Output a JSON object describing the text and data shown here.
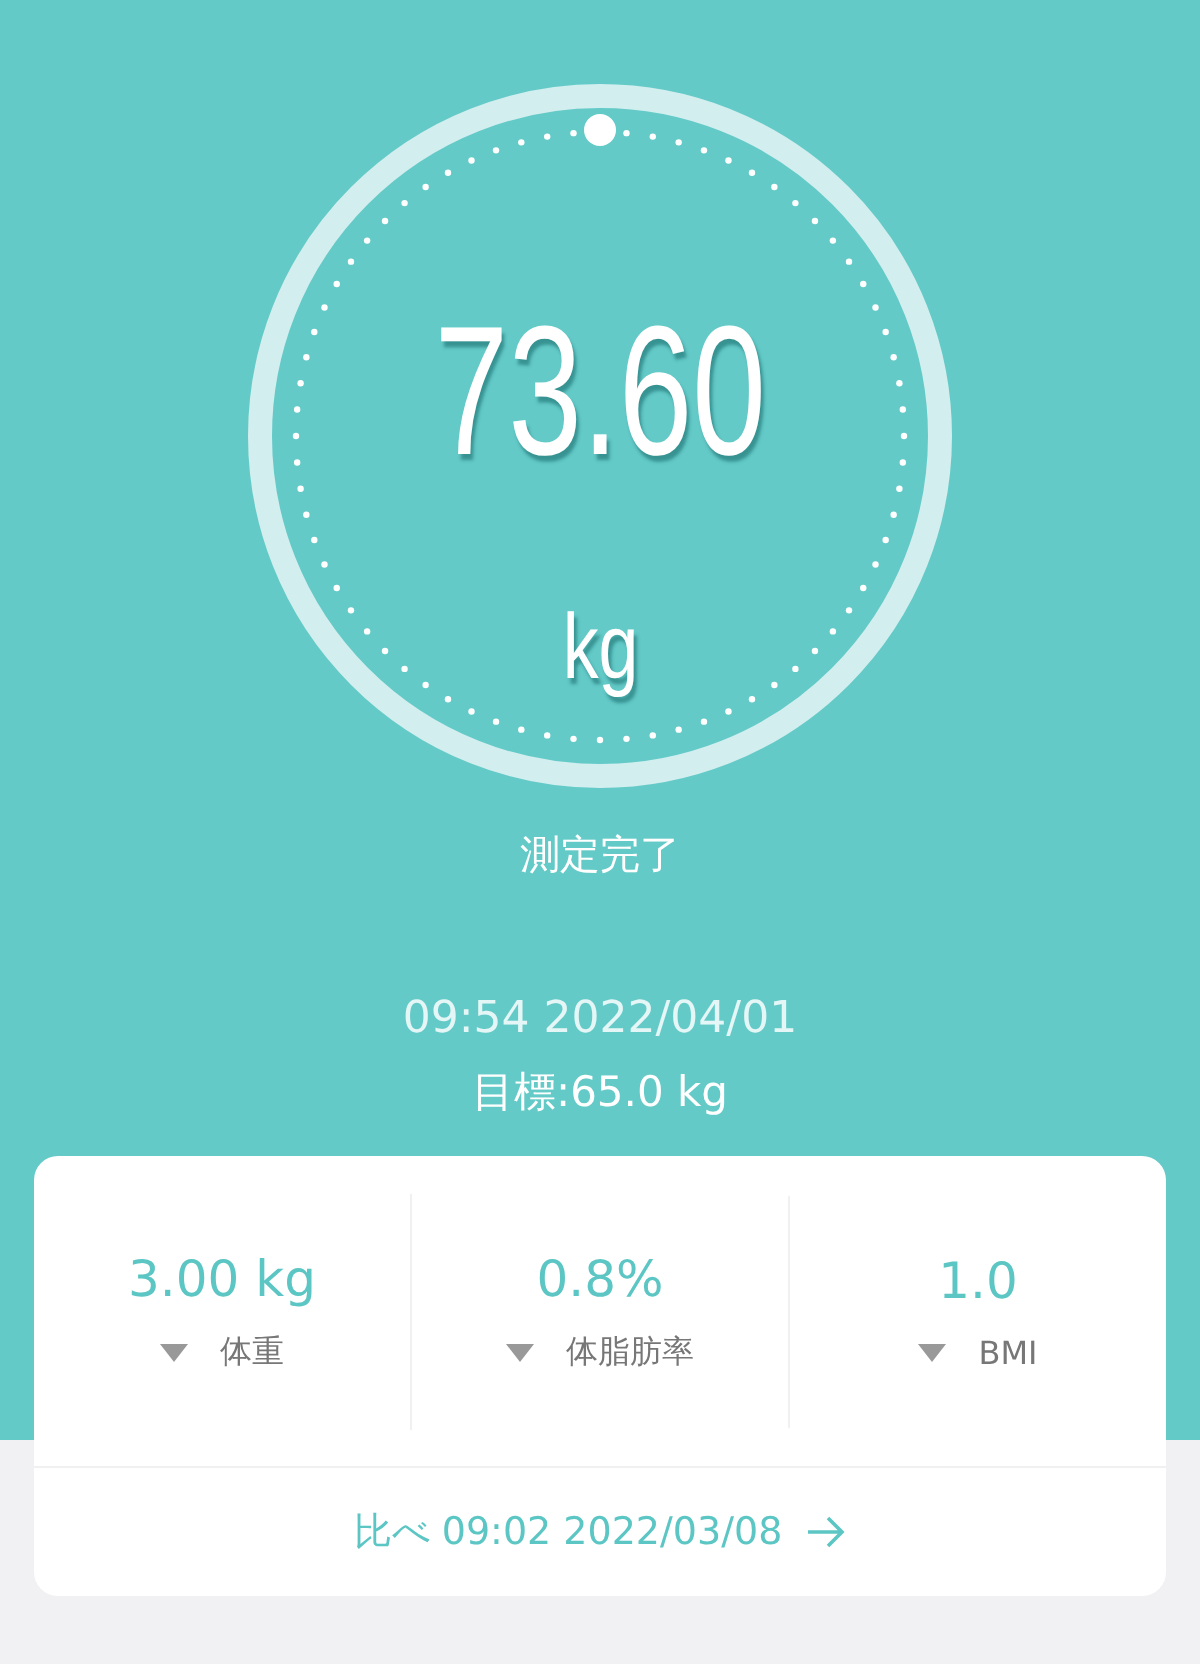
{
  "gauge": {
    "value": "73.60",
    "unit": "kg",
    "status": "測定完了"
  },
  "measured_at": "09:54 2022/04/01",
  "goal": "目標:65.0 kg",
  "stats": [
    {
      "value": "3.00 kg",
      "label": "体重"
    },
    {
      "value": "0.8%",
      "label": "体脂肪率"
    },
    {
      "value": "1.0",
      "label": "BMI"
    }
  ],
  "compare": {
    "label": "比べ 09:02 2022/03/08"
  }
}
